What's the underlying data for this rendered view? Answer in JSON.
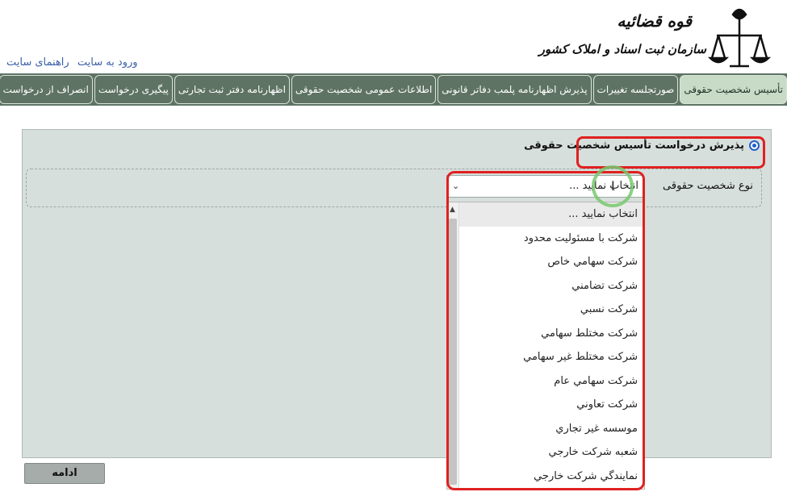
{
  "header": {
    "logo_title": "قوه قضائیه",
    "logo_subtitle": "سازمان ثبت اسناد و املاک کشور",
    "links": [
      "ورود به سایت",
      "راهنمای سایت"
    ]
  },
  "nav": {
    "tabs": [
      {
        "label": "تأسیس شخصیت حقوقی",
        "active": true
      },
      {
        "label": "صورتجلسه تغییرات",
        "active": false
      },
      {
        "label": "پذیرش اظهارنامه پلمب دفاتر قانونی",
        "active": false
      },
      {
        "label": "اطلاعات عمومی شخصیت حقوقی",
        "active": false
      },
      {
        "label": "اظهارنامه دفتر ثبت تجارتی",
        "active": false
      },
      {
        "label": "پیگیری درخواست",
        "active": false
      },
      {
        "label": "انصراف از درخواست",
        "active": false
      }
    ]
  },
  "form": {
    "radio_label": "پذیرش درخواست تأسیس شخصیت حقوقی",
    "field_label": "نوع شخصیت حقوقی",
    "select_value": "انتخاب نمایید ...",
    "options": [
      "انتخاب نمایید ...",
      "شرکت با مسئولیت محدود",
      "شرکت سهامي خاص",
      "شرکت تضامني",
      "شرکت نسبي",
      "شرکت مختلط سهامي",
      "شرکت مختلط غير سهامي",
      "شرکت سهامي عام",
      "شرکت تعاوني",
      "موسسه غير تجاري",
      "شعبه شرکت خارجي",
      "نمايندگي شرکت خارجي"
    ],
    "continue_label": "ادامه"
  },
  "colors": {
    "nav_bg": "#5e7363",
    "active_tab_bg": "#c7dbc7",
    "panel_bg": "#d7dfdc",
    "highlight_red": "#e02020",
    "link_blue": "#3a5fa8"
  }
}
